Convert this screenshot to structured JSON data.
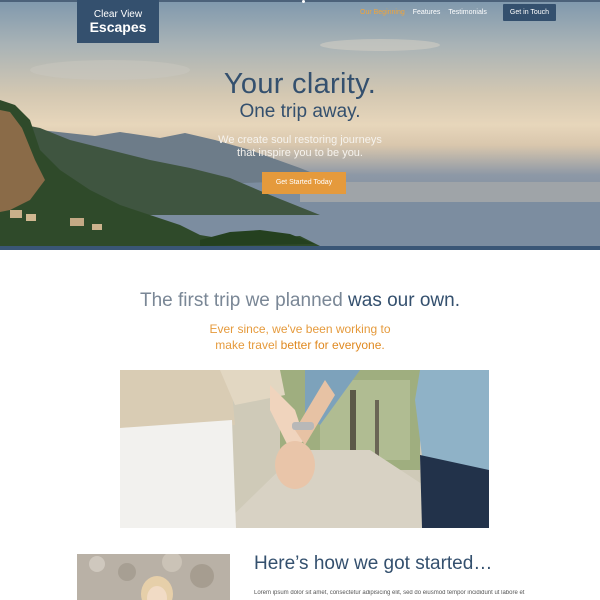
{
  "brand": {
    "line1": "Clear View",
    "line2": "Escapes"
  },
  "nav": {
    "items": [
      "Our Beginning",
      "Features",
      "Testimonials"
    ],
    "cta": "Get in Touch"
  },
  "hero": {
    "title": "Your clarity.",
    "subtitle": "One trip away.",
    "description_line1": "We create soul restoring journeys",
    "description_line2": "that inspire you to be you.",
    "button": "Get Started Today"
  },
  "story": {
    "title_light": "The first trip we planned",
    "title_strong": "was our own.",
    "line1": "Ever since, we've been working to",
    "line2_light": "make travel",
    "line2_strong": "better for everyone."
  },
  "started": {
    "title": "Here’s how we got started…",
    "body": "Lorem ipsum dolor sit amet, consectetur adipisicing elit, sed do eiusmod tempor incididunt ut labore et"
  },
  "colors": {
    "navy": "#34506e",
    "accent": "#e59a3c"
  }
}
